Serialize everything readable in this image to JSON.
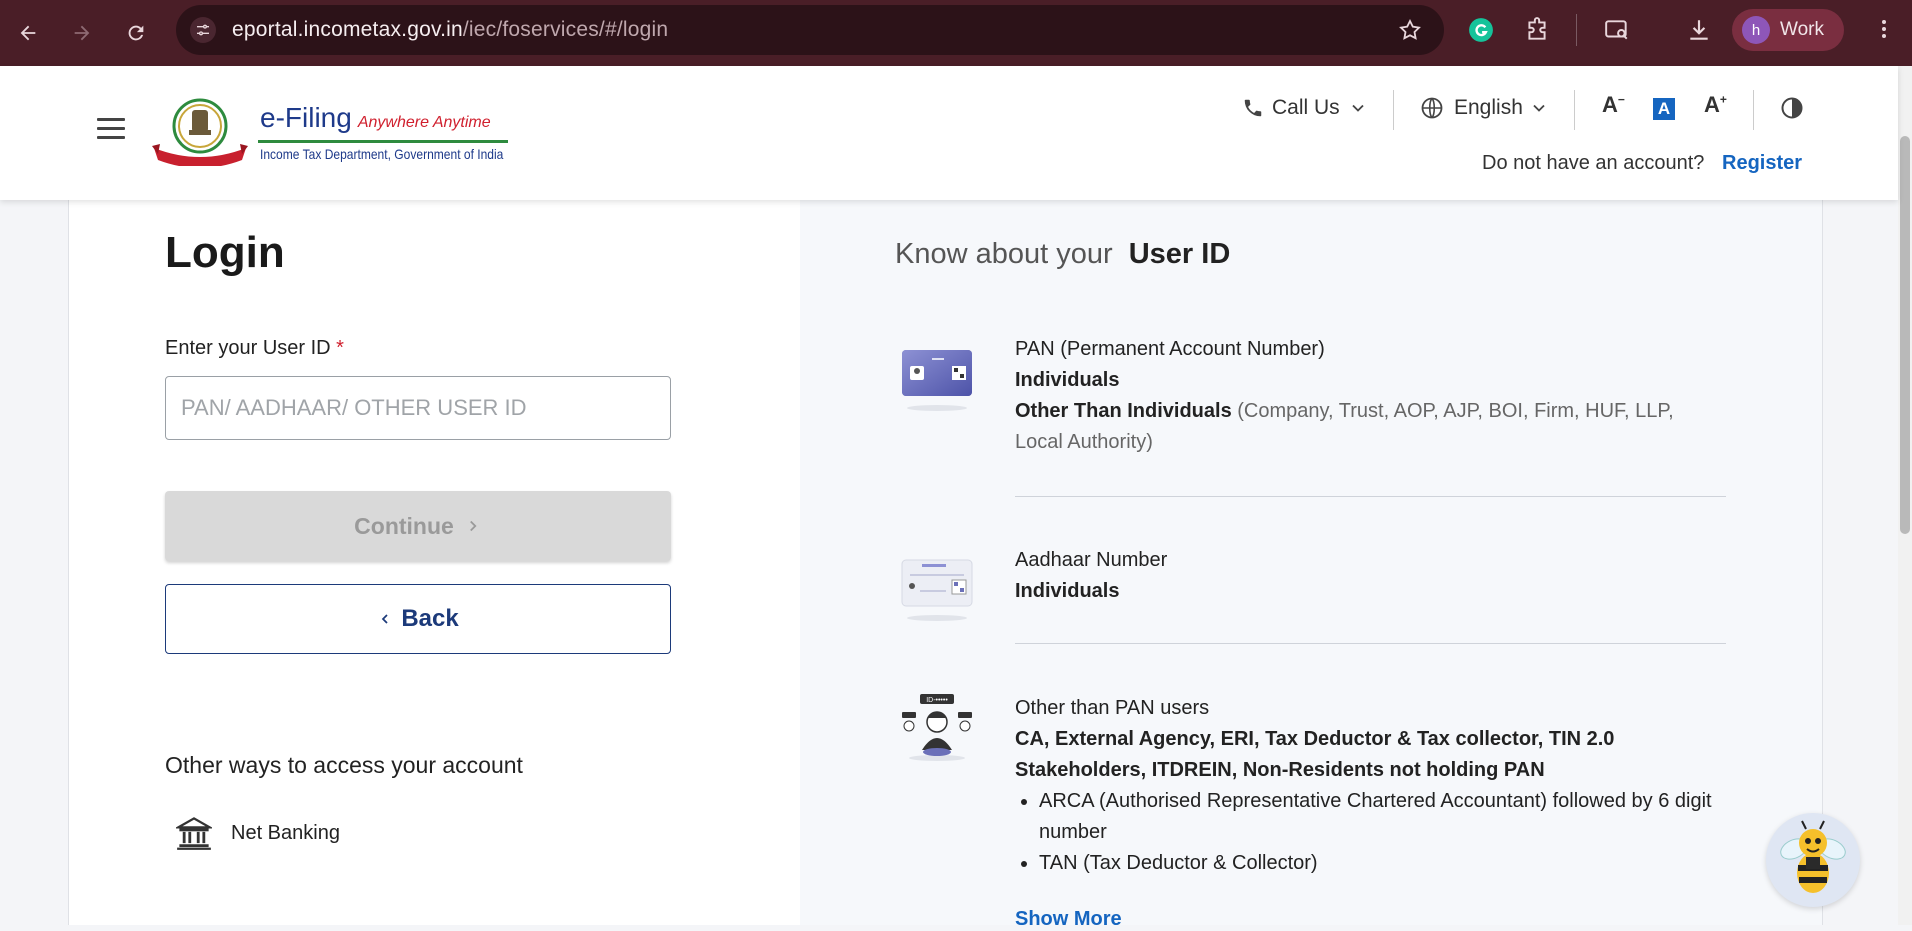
{
  "browser": {
    "url_host": "eportal.incometax.gov.in",
    "url_path": "/iec/foservices/#/login",
    "profile_initial": "h",
    "profile_name": "Work"
  },
  "header": {
    "logo_title": "e-Filing",
    "logo_tagline": "Anywhere Anytime",
    "logo_subtitle": "Income Tax Department, Government of India",
    "call_us": "Call Us",
    "language": "English",
    "font_decrease": "A",
    "font_default": "A",
    "font_increase": "A",
    "no_account_text": "Do not have an account?",
    "register_label": "Register"
  },
  "login": {
    "title": "Login",
    "user_id_label": "Enter your User ID",
    "required_mark": "*",
    "user_id_placeholder": "PAN/ AADHAAR/ OTHER USER ID",
    "continue_label": "Continue",
    "back_label": "Back",
    "other_ways_heading": "Other ways to access your account",
    "net_banking_label": "Net Banking"
  },
  "know": {
    "title_prefix": "Know about your",
    "title_emphasis": "User ID",
    "pan": {
      "heading": "PAN (Permanent Account Number)",
      "line1": "Individuals",
      "line2_bold": "Other Than Individuals",
      "line2_muted": "(Company, Trust, AOP, AJP, BOI, Firm, HUF, LLP,",
      "line3_muted": "Local Authority)"
    },
    "aadhaar": {
      "heading": "Aadhaar Number",
      "line1": "Individuals"
    },
    "other": {
      "heading": "Other than PAN users",
      "line1": "CA, External Agency, ERI, Tax Deductor & Tax collector, TIN 2.0",
      "line2": "Stakeholders, ITDREIN, Non-Residents not holding PAN",
      "bullets": [
        "ARCA (Authorised Representative Chartered Accountant) followed by 6 digit number",
        "TAN (Tax Deductor & Collector)"
      ]
    },
    "show_more": "Show More"
  }
}
